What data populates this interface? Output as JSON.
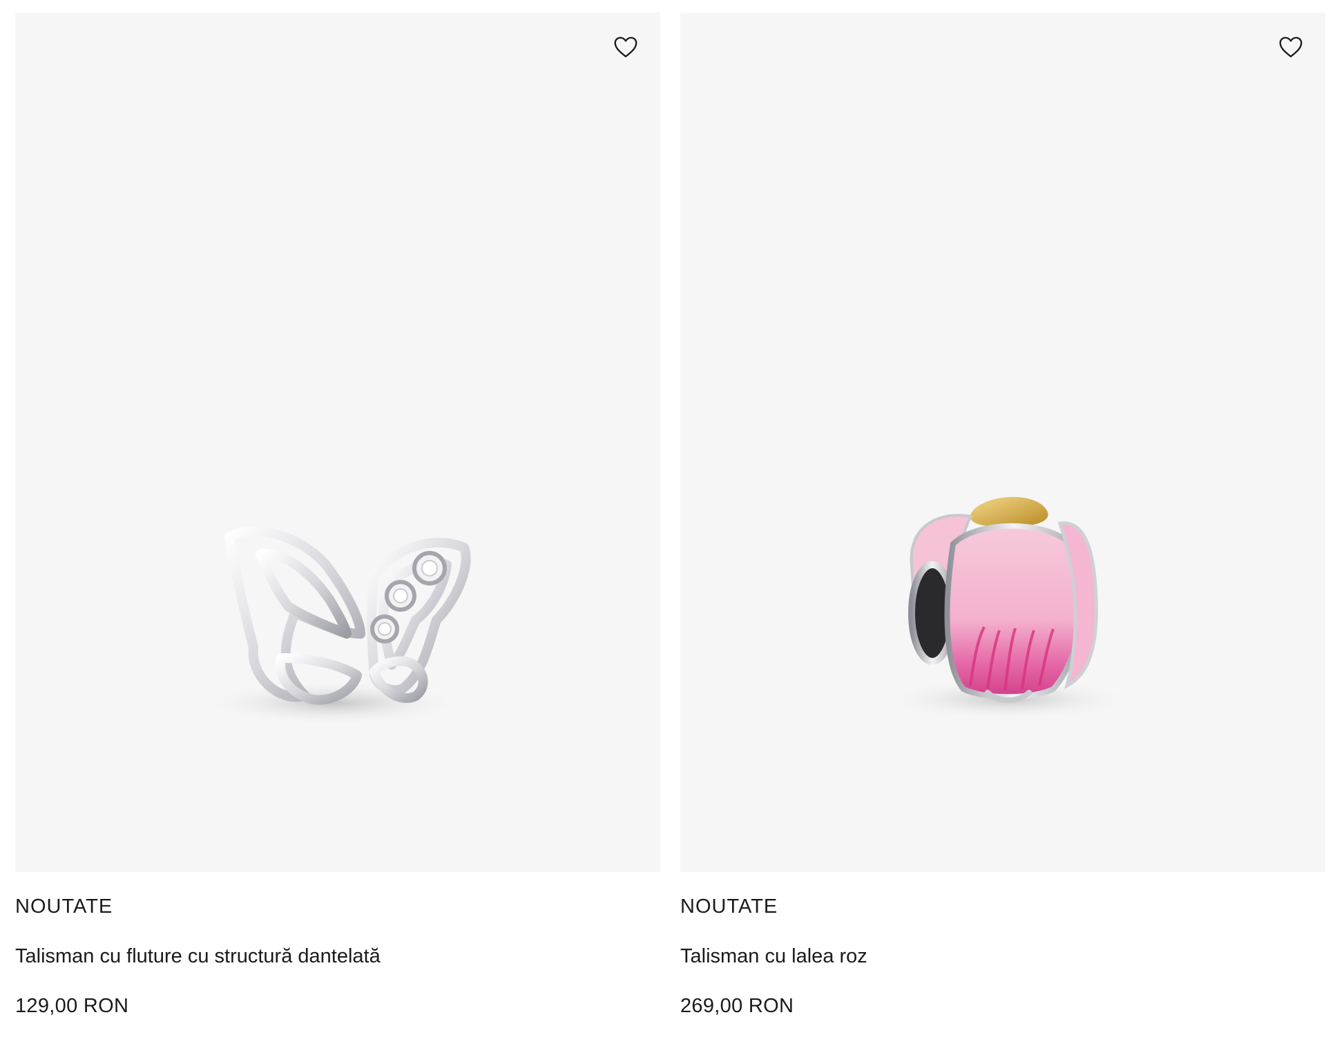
{
  "products": [
    {
      "badge": "NOUTATE",
      "name": "Talisman cu fluture cu structură dantelată",
      "price": "129,00 RON",
      "image_alt": "butterfly-charm",
      "wishlist_icon": "heart-outline-icon"
    },
    {
      "badge": "NOUTATE",
      "name": "Talisman cu lalea roz",
      "price": "269,00 RON",
      "image_alt": "pink-tulip-charm",
      "wishlist_icon": "heart-outline-icon"
    }
  ],
  "colors": {
    "tile_background": "#f6f6f6",
    "text": "#1a1a1a",
    "silver": "#cfcfd3",
    "pink": "#f1a9c7",
    "magenta": "#e0559b",
    "gold": "#d8b04a"
  }
}
